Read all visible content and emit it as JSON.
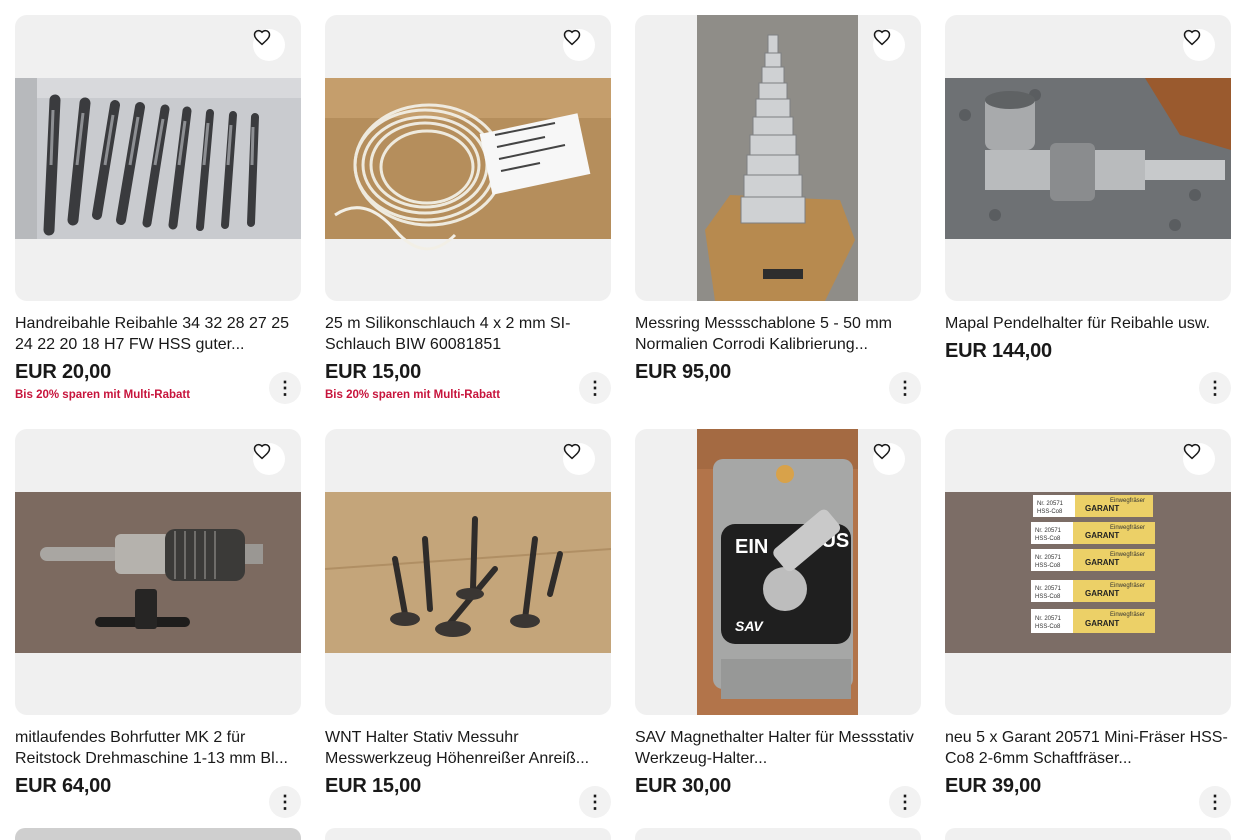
{
  "listings": [
    {
      "title": "Handreibahle Reibahle 34 32 28 27 25 24 22 20 18 H7 FW HSS guter...",
      "price": "EUR 20,00",
      "promo": "Bis 20% sparen mit Multi-Rabatt",
      "watch_icon": "heart-icon",
      "more_icon": "more-vertical-icon",
      "image": "reamers-photo"
    },
    {
      "title": "25 m Silikonschlauch 4 x 2 mm SI-Schlauch BIW 60081851",
      "price": "EUR 15,00",
      "promo": "Bis 20% sparen mit Multi-Rabatt",
      "watch_icon": "heart-icon",
      "more_icon": "more-vertical-icon",
      "image": "silicone-hose-photo"
    },
    {
      "title": "Messring Messschablone 5 - 50 mm Normalien Corrodi Kalibrierung...",
      "price": "EUR 95,00",
      "promo": "",
      "watch_icon": "heart-icon",
      "more_icon": "more-vertical-icon",
      "image": "measuring-rings-photo"
    },
    {
      "title": "Mapal Pendelhalter für Reibahle usw.",
      "price": "EUR 144,00",
      "promo": "",
      "watch_icon": "heart-icon",
      "more_icon": "more-vertical-icon",
      "image": "pendulum-holder-photo"
    },
    {
      "title": "mitlaufendes Bohrfutter MK 2 für Reitstock Drehmaschine 1-13 mm Bl...",
      "price": "EUR 64,00",
      "promo": "",
      "watch_icon": "heart-icon",
      "more_icon": "more-vertical-icon",
      "image": "drill-chuck-photo"
    },
    {
      "title": "WNT Halter Stativ Messuhr Messwerkzeug Höhenreißer Anreiß...",
      "price": "EUR 15,00",
      "promo": "",
      "watch_icon": "heart-icon",
      "more_icon": "more-vertical-icon",
      "image": "gauge-stands-photo"
    },
    {
      "title": "SAV Magnethalter Halter für Messstativ Werkzeug-Halter...",
      "price": "EUR 30,00",
      "promo": "",
      "watch_icon": "heart-icon",
      "more_icon": "more-vertical-icon",
      "image": "magnetic-base-photo"
    },
    {
      "title": "neu 5 x Garant 20571 Mini-Fräser HSS-Co8 2-6mm Schaftfräser...",
      "price": "EUR 39,00",
      "promo": "",
      "watch_icon": "heart-icon",
      "more_icon": "more-vertical-icon",
      "image": "end-mills-photo"
    }
  ],
  "image_text": {
    "magnet_on": "EIN",
    "magnet_off": "AUS",
    "magnet_brand": "SAV",
    "garant": "GARANT",
    "garant_item": "Nr. 20571",
    "garant_spec": "HSS-Co8",
    "garant_label": "Einwegfräser"
  },
  "colors": {
    "promo": "#c7143c",
    "card_bg": "#f0f0f0",
    "text": "#191919"
  }
}
